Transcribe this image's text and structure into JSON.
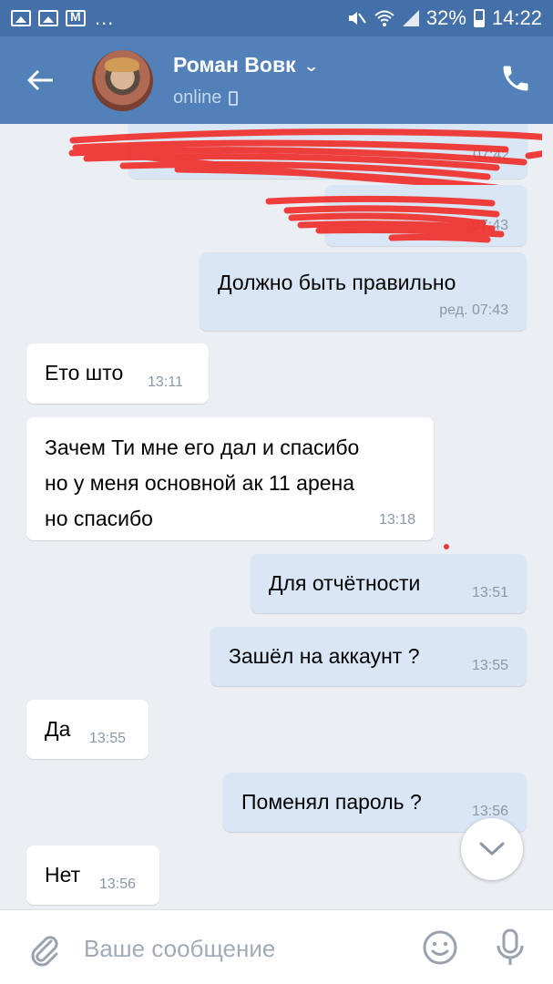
{
  "status_bar": {
    "battery": "32%",
    "time": "14:22",
    "dots": "..."
  },
  "header": {
    "name": "Роман Вовк",
    "status": "online"
  },
  "messages": [
    {
      "side": "out",
      "text": "",
      "time": "07:42",
      "redacted": true
    },
    {
      "side": "out",
      "text": "",
      "time": "07:43",
      "redacted": true
    },
    {
      "side": "out",
      "text": "Должно быть правильно",
      "time": "ред. 07:43"
    },
    {
      "side": "in",
      "text": "Ето што",
      "time": "13:11"
    },
    {
      "side": "in",
      "text": "Зачем Ти мне его дал и спасибо\nно у меня основной ак 11 арена\nно спасибо",
      "time": "13:18"
    },
    {
      "side": "out",
      "text": "Для отчётности",
      "time": "13:51"
    },
    {
      "side": "out",
      "text": "Зашёл на аккаунт ?",
      "time": "13:55"
    },
    {
      "side": "in",
      "text": "Да",
      "time": "13:55"
    },
    {
      "side": "out",
      "text": "Поменял пароль ?",
      "time": "13:56"
    },
    {
      "side": "in",
      "text": "Нет",
      "time": "13:56"
    }
  ],
  "composer": {
    "placeholder": "Ваше сообщение"
  },
  "colors": {
    "header_bg": "#5181b8",
    "status_bg": "#4370a8",
    "outgoing_bubble": "#d9e6f5",
    "incoming_bubble": "#ffffff",
    "chat_bg": "#ebeef3",
    "redaction": "#f0302c"
  },
  "icons": {
    "back": "arrow-left-icon",
    "call": "phone-icon",
    "attach": "paperclip-icon",
    "emoji": "smiley-icon",
    "mic": "microphone-icon",
    "scroll": "chevron-down-icon"
  }
}
